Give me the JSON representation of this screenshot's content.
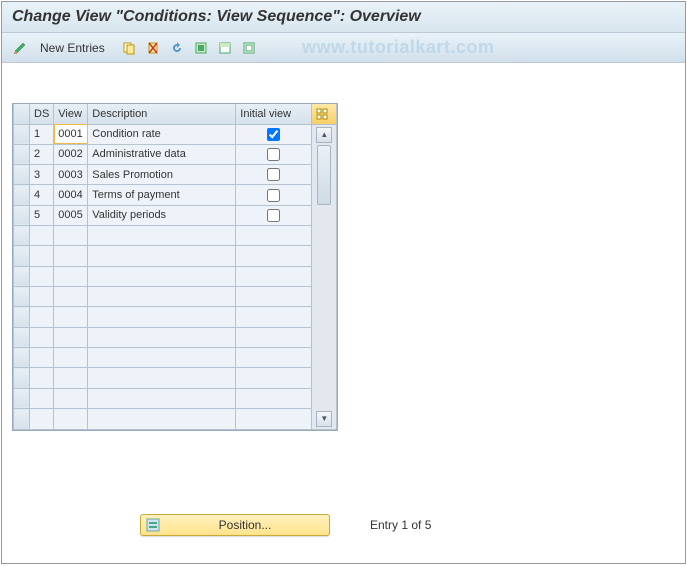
{
  "title": "Change View \"Conditions: View Sequence\": Overview",
  "toolbar": {
    "new_entries_label": "New Entries"
  },
  "watermark": "www.tutorialkart.com",
  "columns": {
    "sel": "",
    "ds": "DS",
    "view": "View",
    "desc": "Description",
    "init": "Initial view"
  },
  "rows": [
    {
      "ds": "1",
      "view": "0001",
      "desc": "Condition rate",
      "init": true
    },
    {
      "ds": "2",
      "view": "0002",
      "desc": "Administrative data",
      "init": false
    },
    {
      "ds": "3",
      "view": "0003",
      "desc": "Sales Promotion",
      "init": false
    },
    {
      "ds": "4",
      "view": "0004",
      "desc": "Terms of payment",
      "init": false
    },
    {
      "ds": "5",
      "view": "0005",
      "desc": "Validity periods",
      "init": false
    }
  ],
  "empty_rows": 10,
  "position_button": {
    "label": "Position..."
  },
  "footer": {
    "entry_text": "Entry 1 of 5"
  }
}
